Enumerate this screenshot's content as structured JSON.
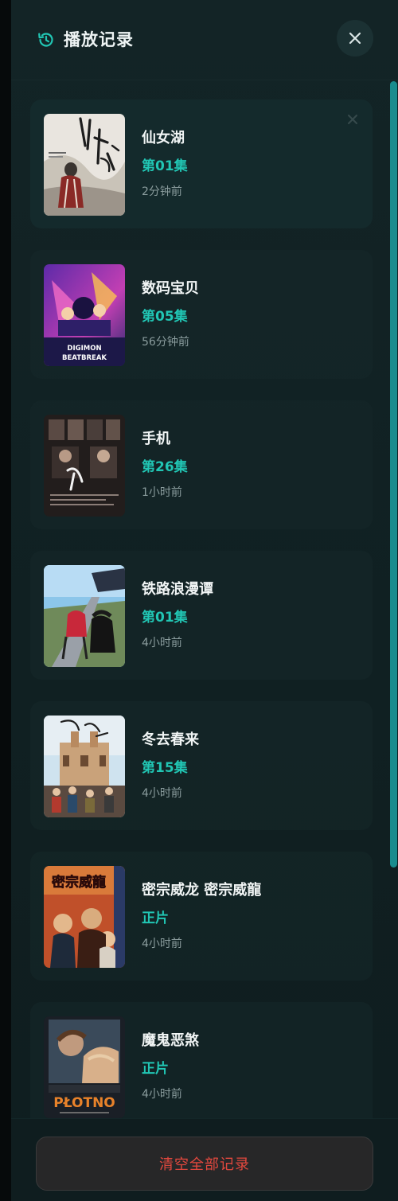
{
  "panel": {
    "title": "播放记录",
    "icons": {
      "title_icon": "history-icon",
      "close_icon": "close-icon",
      "remove_icon": "close-icon"
    }
  },
  "colors": {
    "accent": "#21c6b4",
    "danger": "#e2483e",
    "scrollbar": "#1a8c8e"
  },
  "history": {
    "items": [
      {
        "title": "仙女湖",
        "episode": "第01集",
        "time": "2分钟前"
      },
      {
        "title": "数码宝贝",
        "episode": "第05集",
        "time": "56分钟前",
        "poster_text": "DIGIMON BEATBREAK"
      },
      {
        "title": "手机",
        "episode": "第26集",
        "time": "1小时前"
      },
      {
        "title": "铁路浪漫谭",
        "episode": "第01集",
        "time": "4小时前"
      },
      {
        "title": "冬去春来",
        "episode": "第15集",
        "time": "4小时前"
      },
      {
        "title": "密宗威龙 密宗威龍",
        "episode": "正片",
        "time": "4小时前",
        "poster_text": "密宗威龍"
      },
      {
        "title": "魔鬼恶煞",
        "episode": "正片",
        "time": "4小时前",
        "poster_text": "PŁOTNO"
      }
    ]
  },
  "footer": {
    "clear_label": "清空全部记录"
  }
}
